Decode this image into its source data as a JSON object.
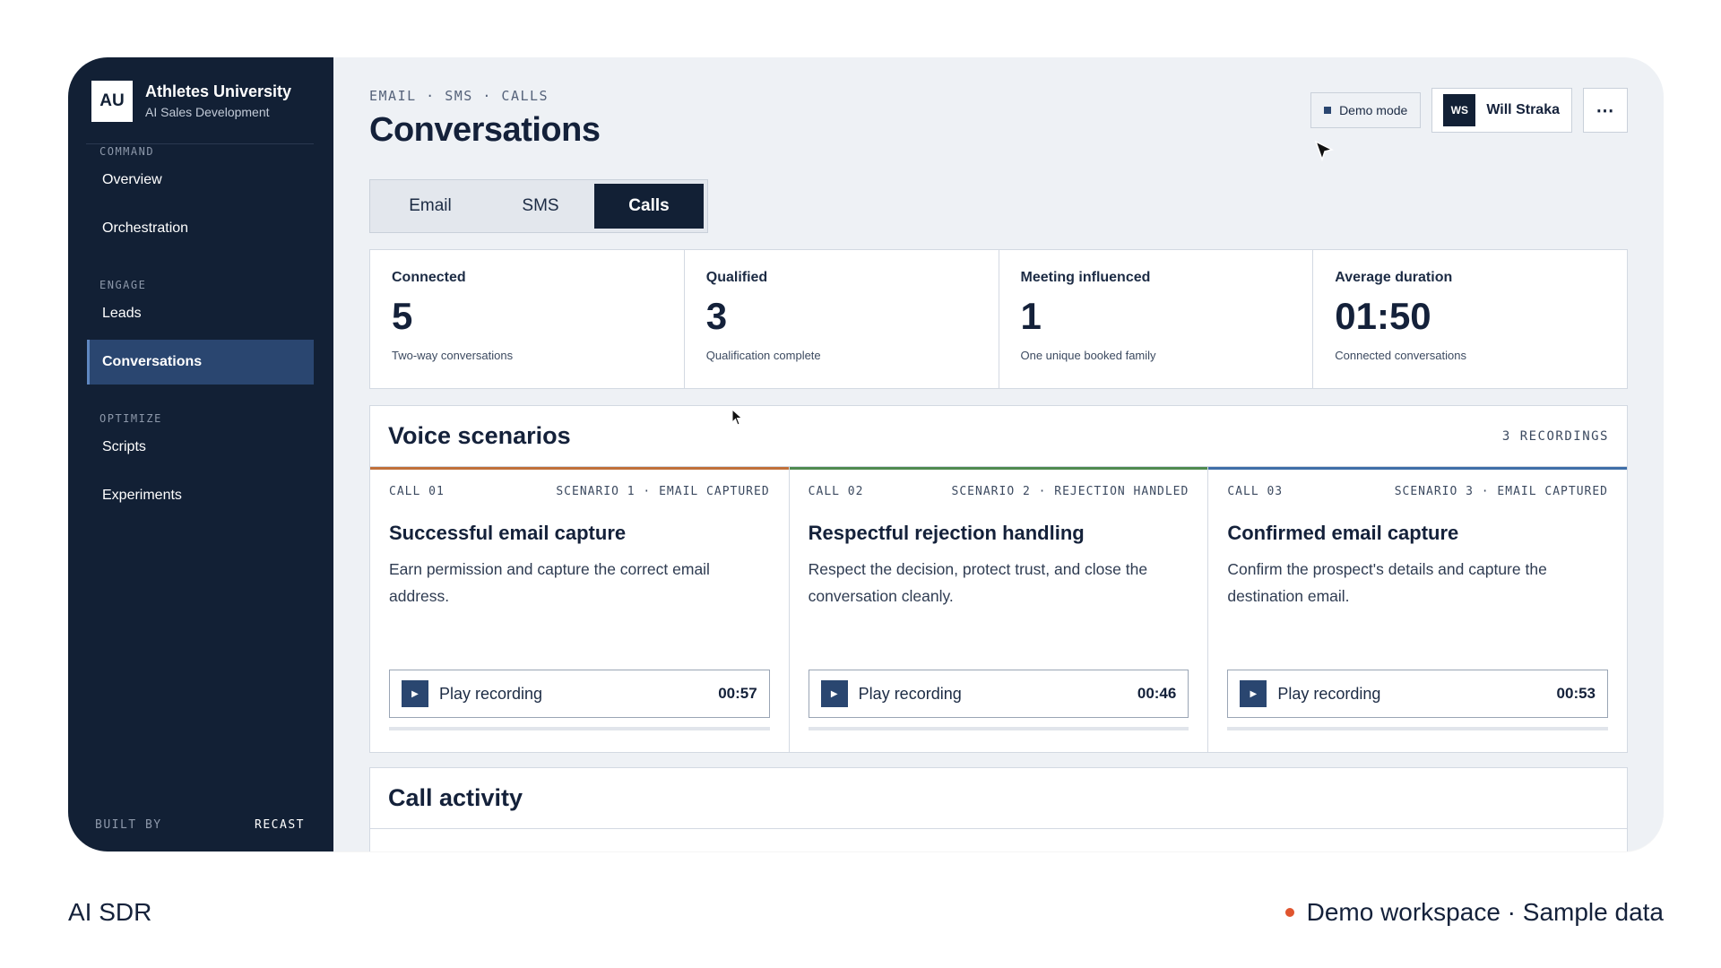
{
  "brand": {
    "logo": "AU",
    "name": "Athletes University",
    "subtitle": "AI Sales Development"
  },
  "sidebar": {
    "sections": [
      {
        "label": "COMMAND",
        "items": [
          "Overview",
          "Orchestration"
        ]
      },
      {
        "label": "ENGAGE",
        "items": [
          "Leads",
          "Conversations"
        ]
      },
      {
        "label": "OPTIMIZE",
        "items": [
          "Scripts",
          "Experiments"
        ]
      }
    ],
    "active_item": "Conversations",
    "footer": {
      "left": "BUILT BY",
      "right": "RECAST"
    }
  },
  "header": {
    "eyebrow": "EMAIL · SMS · CALLS",
    "title": "Conversations",
    "demo_badge": "Demo mode",
    "user": {
      "initials": "WS",
      "name": "Will Straka"
    },
    "more_icon": "more-horizontal-icon"
  },
  "tabs": [
    {
      "label": "Email",
      "active": false
    },
    {
      "label": "SMS",
      "active": false
    },
    {
      "label": "Calls",
      "active": true
    }
  ],
  "stats": [
    {
      "label": "Connected",
      "value": "5",
      "sub": "Two-way conversations"
    },
    {
      "label": "Qualified",
      "value": "3",
      "sub": "Qualification complete"
    },
    {
      "label": "Meeting influenced",
      "value": "1",
      "sub": "One unique booked family"
    },
    {
      "label": "Average duration",
      "value": "01:50",
      "sub": "Connected conversations"
    }
  ],
  "scenarios": {
    "title": "Voice scenarios",
    "count": "3 RECORDINGS",
    "cards": [
      {
        "call": "CALL 01",
        "tag": "SCENARIO 1 · EMAIL CAPTURED",
        "title": "Successful email capture",
        "desc": "Earn permission and capture the correct email address.",
        "play_label": "Play recording",
        "duration": "00:57",
        "accent": "#c0703a"
      },
      {
        "call": "CALL 02",
        "tag": "SCENARIO 2 · REJECTION HANDLED",
        "title": "Respectful rejection handling",
        "desc": "Respect the decision, protect trust, and close the conversation cleanly.",
        "play_label": "Play recording",
        "duration": "00:46",
        "accent": "#4f8a4f"
      },
      {
        "call": "CALL 03",
        "tag": "SCENARIO 3 · EMAIL CAPTURED",
        "title": "Confirmed email capture",
        "desc": "Confirm the prospect's details and capture the destination email.",
        "play_label": "Play recording",
        "duration": "00:53",
        "accent": "#3f6ea8"
      }
    ]
  },
  "activity": {
    "title": "Call activity"
  },
  "caption": {
    "left": "AI SDR",
    "right": "Demo workspace · Sample data"
  },
  "colors": {
    "sidebar_bg": "#122035",
    "active_nav": "#2a4670",
    "caption_dot": "#e0552f"
  }
}
